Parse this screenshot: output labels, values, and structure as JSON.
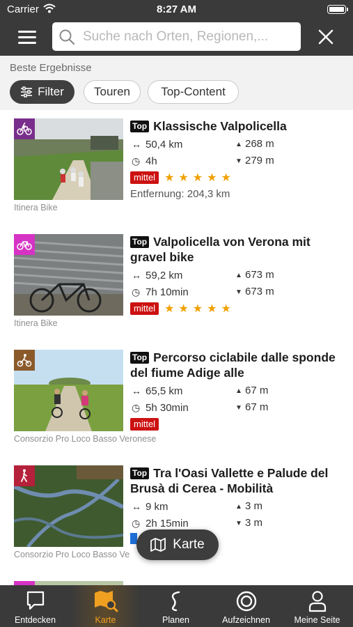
{
  "status_bar": {
    "carrier": "Carrier",
    "time": "8:27 AM"
  },
  "header": {
    "search_placeholder": "Suche nach Orten, Regionen,..."
  },
  "filters": {
    "section_label": "Beste Ergebnisse",
    "chips": [
      "Filter",
      "Touren",
      "Top-Content"
    ]
  },
  "colors": {
    "accent": "#f0a020",
    "difficulty": "#cc1111",
    "header_bg": "#3a3a3a"
  },
  "results": [
    {
      "top_label": "Top",
      "title": "Klassische Valpolicella",
      "category_icon": "ebike-icon",
      "category_color": "#7a2e8c",
      "distance": "50,4 km",
      "duration": "4h",
      "ascent": "268 m",
      "descent": "279 m",
      "difficulty": "mittel",
      "rating": 5,
      "rating_stars": "★★★★★",
      "entfernung": "Entfernung: 204,3 km",
      "source": "Itinera Bike"
    },
    {
      "top_label": "Top",
      "title": "Valpolicella von Verona mit gravel bike",
      "category_icon": "bike-icon",
      "category_color": "#d633c4",
      "distance": "59,2 km",
      "duration": "7h 10min",
      "ascent": "673 m",
      "descent": "673 m",
      "difficulty": "mittel",
      "rating": 5,
      "rating_stars": "★★★★★",
      "source": "Itinera Bike"
    },
    {
      "top_label": "Top",
      "title": "Percorso ciclabile dalle sponde del fiume Adige alle",
      "category_icon": "cyclist-icon",
      "category_color": "#8b5a2b",
      "distance": "65,5 km",
      "duration": "5h 30min",
      "ascent": "67 m",
      "descent": "67 m",
      "difficulty": "mittel",
      "source": "Consorzio Pro Loco Basso Veronese"
    },
    {
      "top_label": "Top",
      "title": "Tra l'Oasi Vallette e Palude del Brusà di Cerea - Mobilità",
      "category_icon": "hiker-icon",
      "category_color": "#b5203a",
      "distance": "9 km",
      "duration": "2h 15min",
      "ascent": "3 m",
      "descent": "3 m",
      "source": "Consorzio Pro Loco Basso Ve"
    }
  ],
  "map_button": {
    "label": "Karte"
  },
  "tabbar": {
    "tabs": [
      {
        "label": "Entdecken",
        "icon": "chat-bubble-icon"
      },
      {
        "label": "Karte",
        "icon": "map-search-icon",
        "active": true
      },
      {
        "label": "Planen",
        "icon": "route-icon"
      },
      {
        "label": "Aufzeichnen",
        "icon": "record-icon"
      },
      {
        "label": "Meine Seite",
        "icon": "person-icon"
      }
    ]
  }
}
